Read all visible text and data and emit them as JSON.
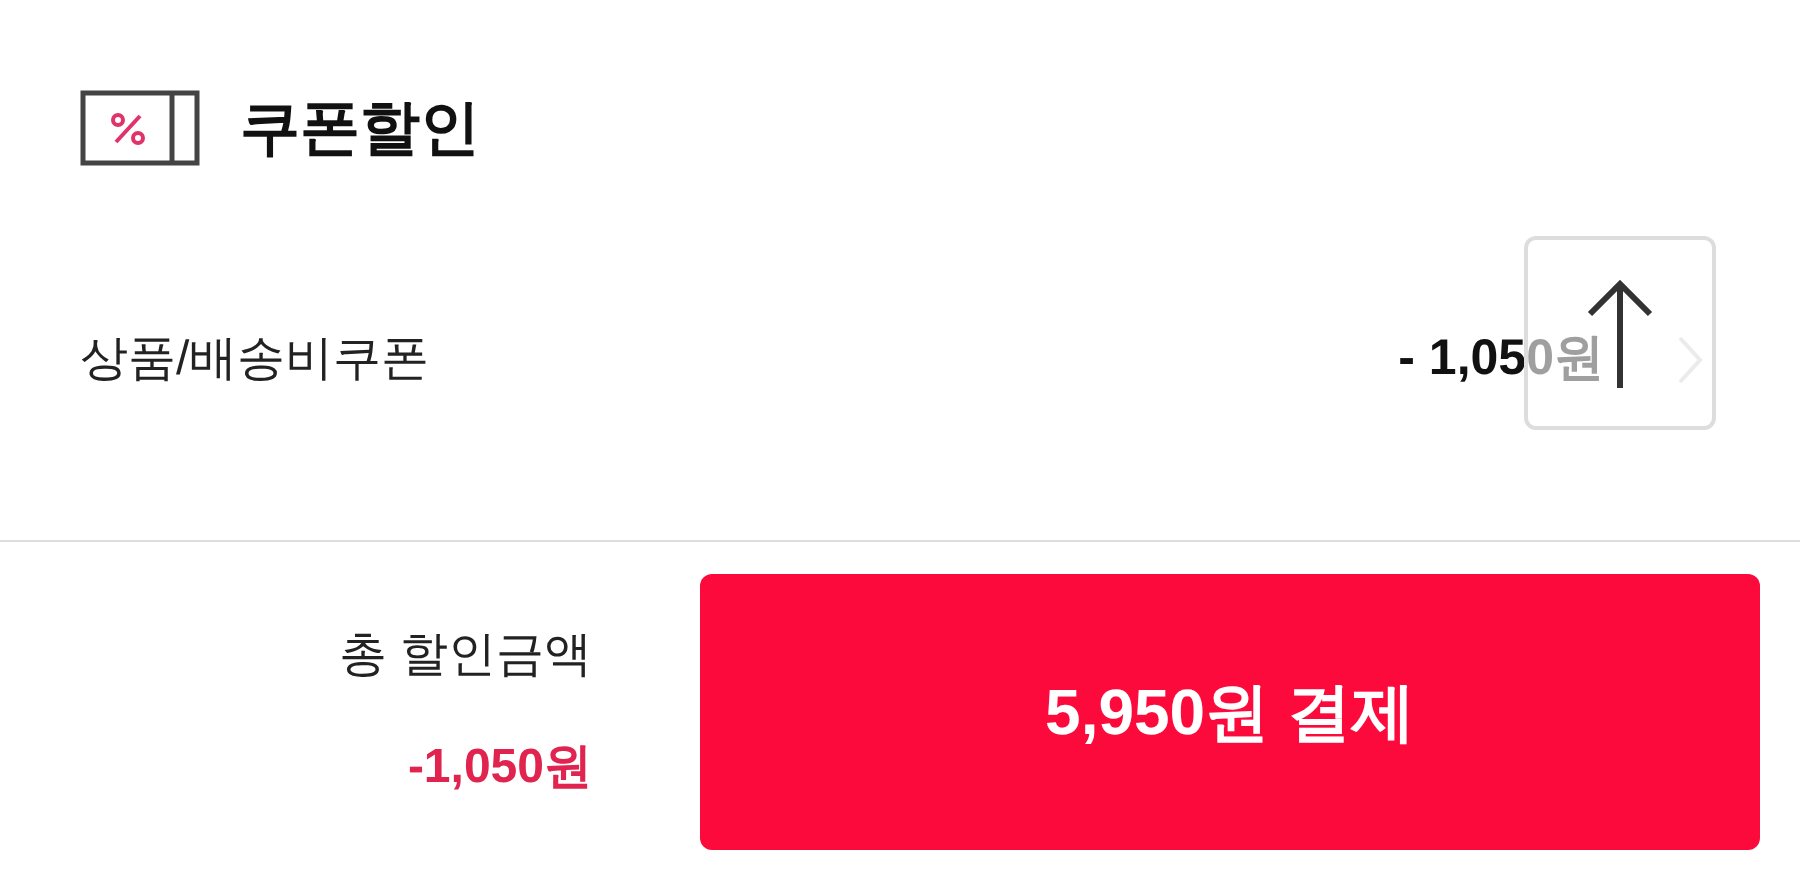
{
  "section": {
    "title": "쿠폰할인"
  },
  "coupon_row": {
    "label": "상품/배송비쿠폰",
    "amount": "- 1,050원"
  },
  "footer": {
    "total_label": "총 할인금액",
    "total_amount": "-1,050원",
    "pay_button": "5,950원 결제"
  }
}
